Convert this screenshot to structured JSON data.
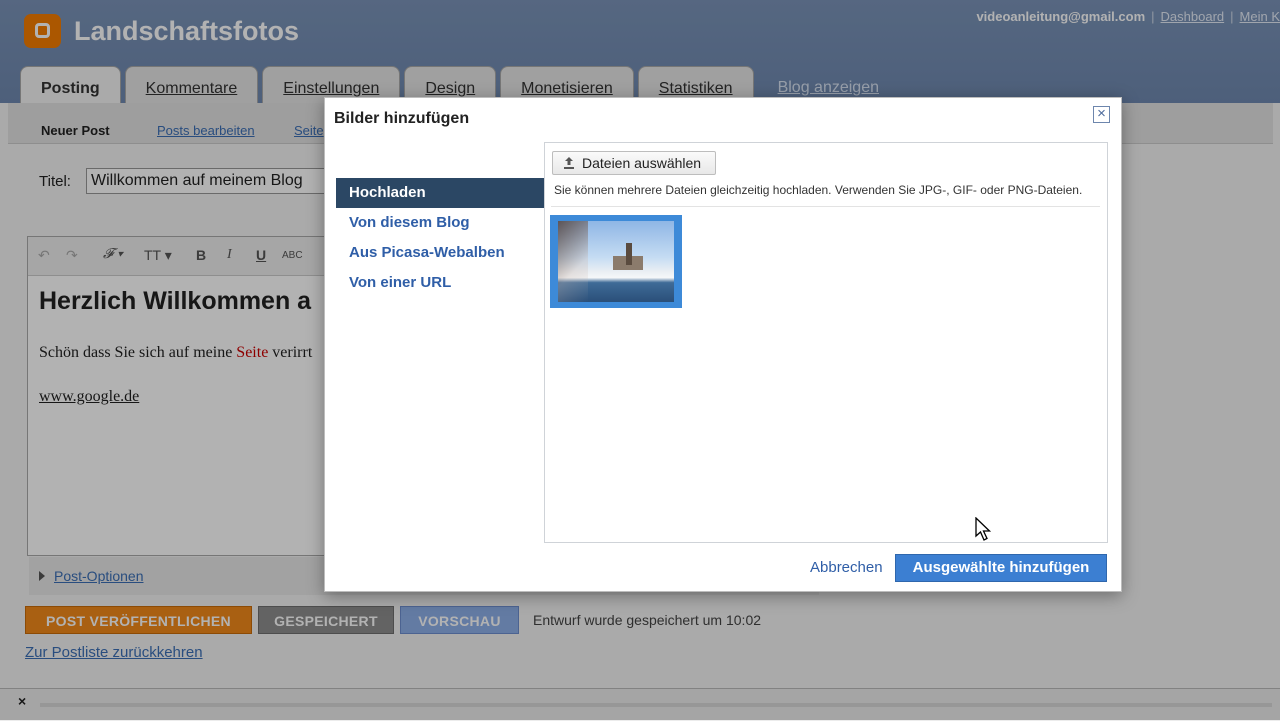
{
  "blog": {
    "title": "Landschaftsfotos",
    "user_email": "videoanleitung@gmail.com",
    "user_links": [
      "Dashboard",
      "Mein K"
    ]
  },
  "tabs": [
    "Posting",
    "Kommentare",
    "Einstellungen",
    "Design",
    "Monetisieren",
    "Statistiken"
  ],
  "view_blog_link": "Blog anzeigen",
  "subnav": [
    "Neuer Post",
    "Posts bearbeiten",
    "Seite"
  ],
  "post": {
    "title_label": "Titel:",
    "title_value": "Willkommen auf meinem Blog",
    "heading": "Herzlich Willkommen a",
    "text_before": "Schön dass Sie sich auf meine ",
    "text_highlight": "Seite",
    "text_after": " verirrt",
    "link": "www.google.de",
    "post_options": "Post-Optionen"
  },
  "toolbar_icons": [
    "undo-icon",
    "redo-icon",
    "font-icon",
    "font-size-icon",
    "bold-icon",
    "italic-icon",
    "underline-icon",
    "strikethrough-icon"
  ],
  "actions": {
    "publish": "POST VERÖFFENTLICHEN",
    "saved": "GESPEICHERT",
    "preview": "VORSCHAU",
    "saved_note": "Entwurf wurde gespeichert um 10:02",
    "back_link": "Zur Postliste zurückkehren"
  },
  "dialog": {
    "title": "Bilder hinzufügen",
    "close": "×",
    "nav": [
      "Hochladen",
      "Von diesem Blog",
      "Aus Picasa-Webalben",
      "Von einer URL"
    ],
    "choose_files": "Dateien auswählen",
    "hint": "Sie können mehrere Dateien gleichzeitig hochladen. Verwenden Sie JPG-, GIF- oder PNG-Dateien.",
    "cancel": "Abbrechen",
    "add_selected": "Ausgewählte hinzufügen"
  },
  "colors": {
    "accent_blue": "#3c7fd2",
    "nav_active": "#2b4764",
    "publish_orange": "#f28a1a"
  }
}
